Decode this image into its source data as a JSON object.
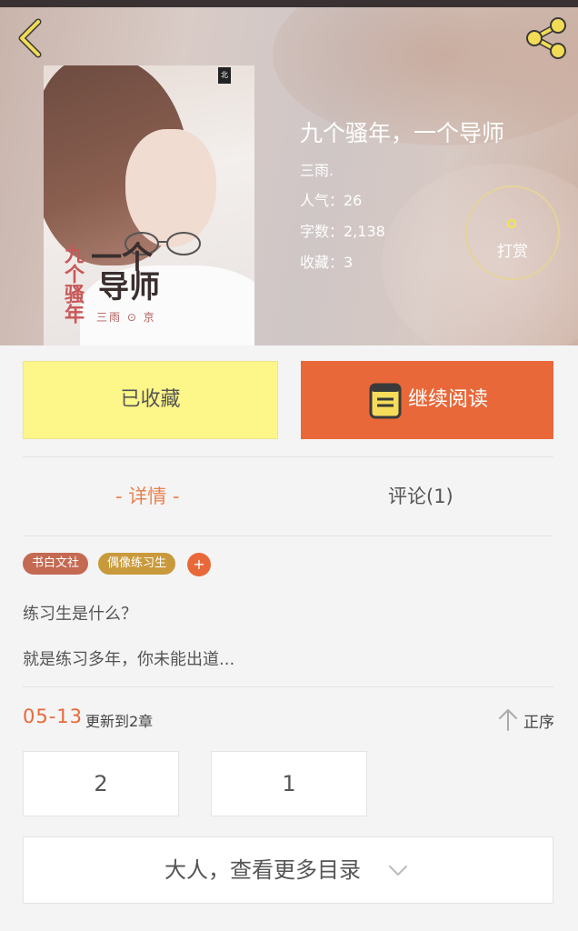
{
  "header": {
    "back_icon": "chevron-left-icon",
    "share_icon": "share-icon"
  },
  "book": {
    "title": "九个骚年，一个导师",
    "author": "三雨.",
    "popularity": "人气：26",
    "word_count": "字数：2,138",
    "favorites": "收藏：3",
    "cover": {
      "publisher_mark": "北",
      "title_main_1": "一个",
      "title_main_2": "导师",
      "title_side": "九个骚年",
      "author": "三雨 ⊙ 京"
    }
  },
  "reward": {
    "label": "打赏"
  },
  "actions": {
    "collected_label": "已收藏",
    "continue_label": "继续阅读"
  },
  "tabs": {
    "detail": "- 详情 -",
    "comments": "评论(1)"
  },
  "tags": [
    "书白文社",
    "偶像练习生"
  ],
  "tag_add": "+",
  "description": {
    "line1": "练习生是什么？",
    "line2": "就是练习多年，你未能出道..."
  },
  "updates": {
    "date": "05-13",
    "text": "更新到2章",
    "sort_label": "正序"
  },
  "chapters": [
    "2",
    "1"
  ],
  "more_catalog": "大人，查看更多目录",
  "colors": {
    "accent": "#e9683a",
    "collected_bg": "#fdf688",
    "tag_1": "#c46a52",
    "tag_2": "#c99a3b"
  }
}
